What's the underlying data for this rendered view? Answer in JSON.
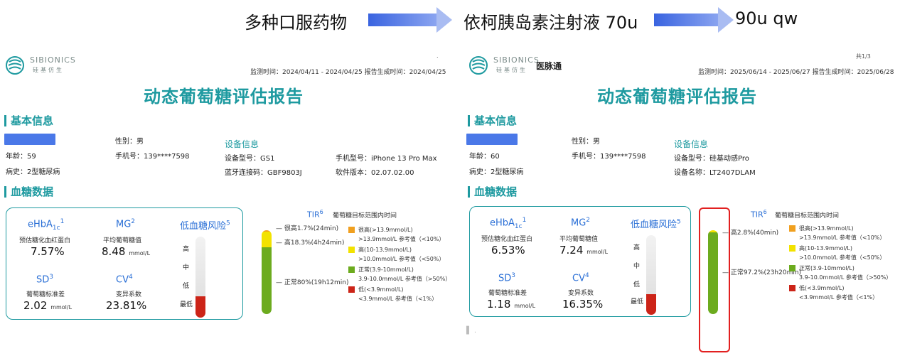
{
  "flow": {
    "step1": "多种口服药物",
    "step2": "依柯胰岛素注射液 70u",
    "step3": "90u qw",
    "arrow_color": "#3a64e0"
  },
  "left": {
    "brand": "SIBIONICS",
    "brand_sub": "硅基仿生",
    "corner": ".",
    "period": "监测时间：2024/04/11 - 2024/04/25 报告生成时间：2024/04/25",
    "title": "动态葡萄糖评估报告",
    "sec_basic": "基本信息",
    "gender": "性别：男",
    "age": "年龄：59",
    "phone": "手机号：139****7598",
    "history": "病史：2型糖尿病",
    "device_title": "设备信息",
    "device_model": "设备型号：GS1",
    "bt_code": "蓝牙连接码：GBF9803J",
    "phone_model": "手机型号：iPhone 13 Pro Max",
    "software": "软件版本：02.07.02.00",
    "sec_glucose": "血糖数据",
    "ehba1c_label": "eHbA",
    "ehba1c_sub": "1c",
    "ehba1c_sup": "1",
    "ehba1c_desc": "预估糖化血红蛋白",
    "ehba1c_value": "7.57%",
    "mg_label": "MG",
    "mg_sup": "2",
    "mg_desc": "平均葡萄糖值",
    "mg_value": "8.48",
    "mg_unit": "mmol/L",
    "sd_label": "SD",
    "sd_sup": "3",
    "sd_desc": "葡萄糖标准差",
    "sd_value": "2.02",
    "sd_unit": "mmol/L",
    "cv_label": "CV",
    "cv_sup": "4",
    "cv_desc": "变异系数",
    "cv_value": "23.81%",
    "risk_title": "低血糖风险",
    "risk_sup": "5",
    "risk_levels": [
      "高",
      "中",
      "低",
      "最低"
    ],
    "risk_level_fraction": 0.26,
    "tir_label": "TIR",
    "tir_sup": "6",
    "tir_sub": "葡萄糖目标范围内时间",
    "tir_very_high": "很高1.7%(24min)",
    "tir_high": "高18.3%(4h24min)",
    "tir_normal": "正常80%(19h12min)",
    "tir_fractions": {
      "very_high": 0.017,
      "high": 0.183,
      "normal": 0.8,
      "low": 0.0
    },
    "legend": [
      [
        "很高(>13.9mmol/L)",
        ">13.9mmol/L 参考值（<10%）"
      ],
      [
        "高(10-13.9mmol/L)",
        ">10.0mmol/L 参考值（<50%）"
      ],
      [
        "正常(3.9-10mmol/L)",
        "3.9-10.0mmol/L 参考值（>50%）"
      ],
      [
        "低(<3.9mmol/L)",
        "<3.9mmol/L 参考值（<1%）"
      ]
    ]
  },
  "right": {
    "brand": "SIBIONICS",
    "brand_sub": "硅基仿生",
    "brand2": "医脉通",
    "corner": "共1/3",
    "period": "监测时间：2025/06/14 - 2025/06/27 报告生成时间：2025/06/28",
    "title": "动态葡萄糖评估报告",
    "sec_basic": "基本信息",
    "gender": "性别：男",
    "age": "年龄：60",
    "phone": "手机号：139****7598",
    "history": "病史：2型糖尿病",
    "device_title": "设备信息",
    "device_model": "设备型号：硅基动感Pro",
    "device_name": "设备名称：LT2407DLAM",
    "sec_glucose": "血糖数据",
    "ehba1c_label": "eHbA",
    "ehba1c_sub": "1c",
    "ehba1c_sup": "1",
    "ehba1c_desc": "预估糖化血红蛋白",
    "ehba1c_value": "6.53%",
    "mg_label": "MG",
    "mg_sup": "2",
    "mg_desc": "平均葡萄糖值",
    "mg_value": "7.24",
    "mg_unit": "mmol/L",
    "sd_label": "SD",
    "sd_sup": "3",
    "sd_desc": "葡萄糖标准差",
    "sd_value": "1.18",
    "sd_unit": "mmol/L",
    "cv_label": "CV",
    "cv_sup": "4",
    "cv_desc": "变异系数",
    "cv_value": "16.35%",
    "risk_title": "低血糖风险",
    "risk_sup": "5",
    "risk_levels": [
      "高",
      "中",
      "低",
      "最低"
    ],
    "risk_level_fraction": 0.26,
    "tir_label": "TIR",
    "tir_sup": "6",
    "tir_sub": "葡萄糖目标范围内时间",
    "tir_high": "高2.8%(40min)",
    "tir_normal": "正常97.2%(23h20min)",
    "tir_fractions": {
      "high": 0.028,
      "normal": 0.972
    },
    "legend": [
      [
        "很高(>13.9mmol/L)",
        ">13.9mmol/L 参考值（<10%）"
      ],
      [
        "高(10-13.9mmol/L)",
        ">10.0mmol/L 参考值（<50%）"
      ],
      [
        "正常(3.9-10mmol/L)",
        "3.9-10.0mmol/L 参考值（>50%）"
      ],
      [
        "低(<3.9mmol/L)",
        "<3.9mmol/L 参考值（<1%）"
      ]
    ],
    "cutoff_heading": "▌ ."
  },
  "colors": {
    "teal": "#1e9aa0",
    "blue_label": "#2a6fd6",
    "very_high": "#f0a020",
    "high": "#f2e200",
    "normal": "#6cab1e",
    "low": "#cc2418",
    "highlight": "#e22020"
  }
}
